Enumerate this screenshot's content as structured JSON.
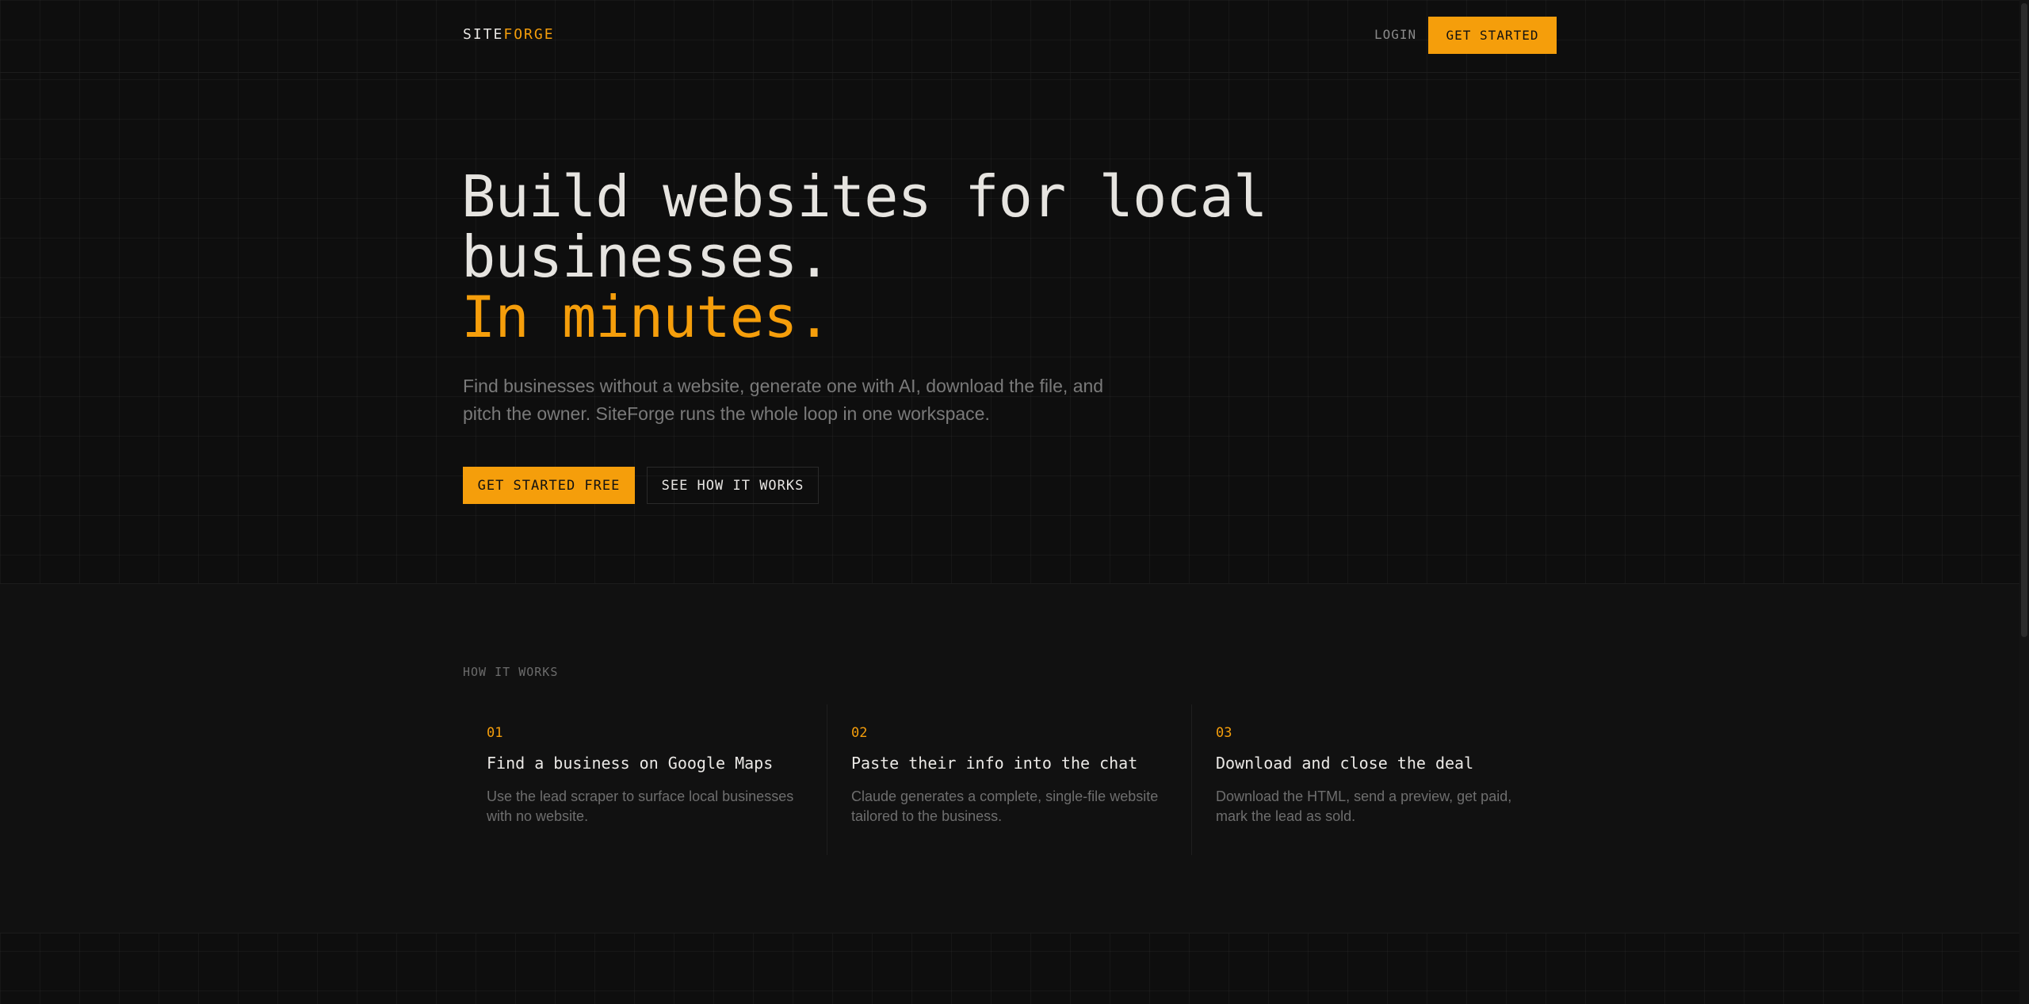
{
  "nav": {
    "logo_part1": "SITE",
    "logo_part2": "FORGE",
    "login_label": "LOGIN",
    "cta_label": "GET STARTED"
  },
  "hero": {
    "title_line1": "Build websites for local",
    "title_line2": "businesses.",
    "title_accent": "In minutes.",
    "subtitle": "Find businesses without a website, generate one with AI, download the file, and pitch the owner. SiteForge runs the whole loop in one workspace.",
    "primary_cta": "GET STARTED FREE",
    "secondary_cta": "SEE HOW IT WORKS"
  },
  "how": {
    "label": "HOW IT WORKS",
    "steps": [
      {
        "num": "01",
        "title": "Find a business on Google Maps",
        "desc": "Use the lead scraper to surface local businesses with no website."
      },
      {
        "num": "02",
        "title": "Paste their info into the chat",
        "desc": "Claude generates a complete, single-file website tailored to the business."
      },
      {
        "num": "03",
        "title": "Download and close the deal",
        "desc": "Download the HTML, send a preview, get paid, mark the lead as sold."
      }
    ]
  },
  "colors": {
    "accent": "#f59e0b",
    "background": "#0e0e0e",
    "section_bg": "#111111"
  }
}
